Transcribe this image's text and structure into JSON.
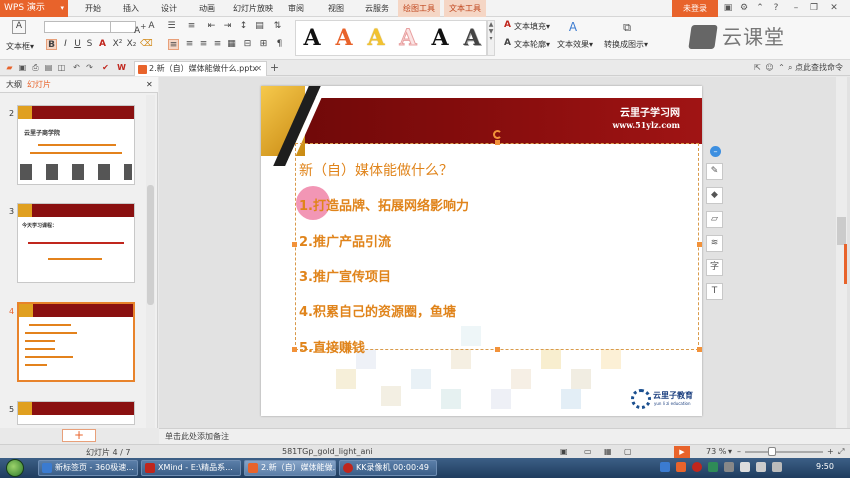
{
  "app": {
    "name": "WPS 演示",
    "menus": [
      "开始",
      "插入",
      "设计",
      "动画",
      "幻灯片放映",
      "审阅",
      "视图",
      "云服务",
      "绘图工具",
      "文本工具"
    ],
    "login": "未登录",
    "accent": "#e8632b"
  },
  "ribbon": {
    "textbox_label": "文本框",
    "font_name": "",
    "font_size": "",
    "text_fill": "文本填充",
    "text_outline": "文本轮廓",
    "text_effect": "文本效果",
    "convert_to_image": "转换成图示",
    "style_letter": "A",
    "brand": "云课堂"
  },
  "tabs": {
    "document": "2.新（自）媒体能做什么.pptx",
    "search_placeholder": "点此查找命令"
  },
  "panel": {
    "tab_outline": "大纲",
    "tab_slides": "幻灯片",
    "slide_numbers": [
      "2",
      "3",
      "4",
      "5"
    ],
    "thumb2_title": "云里子商学院",
    "thumb3_title": "今天学习课程："
  },
  "slide": {
    "banner_title": "云里子学习网",
    "banner_url": "www.51ylz.com",
    "question": "新（自）媒体能做什么？",
    "items": [
      "1.打造品牌、拓展网络影响力",
      "2.推广产品引流",
      "3.推广宣传项目",
      "4.积累自己的资源圈，鱼塘",
      "5.直接赚钱"
    ],
    "logo_name": "云里子教育",
    "logo_sub": "yun li zi education"
  },
  "notes": {
    "placeholder": "单击此处添加备注"
  },
  "status": {
    "slide_counter": "幻灯片 4 / 7",
    "theme": "581TGp_gold_light_ani",
    "zoom": "73 %"
  },
  "taskbar": {
    "items": [
      "新标签页 - 360极速...",
      "XMind - E:\\精品系...",
      "2.新（自）媒体能做...",
      "KK录像机 00:00:49"
    ],
    "clock": "9:50"
  }
}
